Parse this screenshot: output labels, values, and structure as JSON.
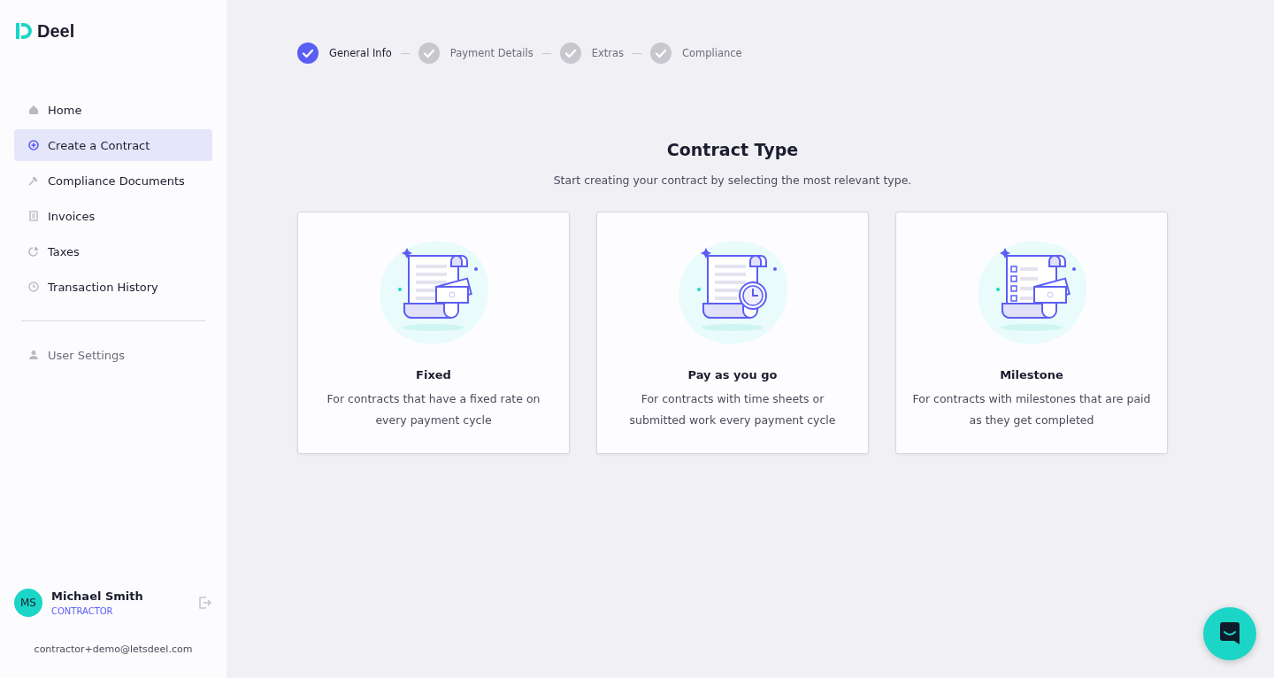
{
  "brand": {
    "name": "Deel"
  },
  "sidebar": {
    "items": [
      {
        "label": "Home",
        "kind": "home",
        "selected": false
      },
      {
        "label": "Create a Contract",
        "kind": "create",
        "selected": true
      },
      {
        "label": "Compliance Documents",
        "kind": "compliance",
        "selected": false
      },
      {
        "label": "Invoices",
        "kind": "invoices",
        "selected": false
      },
      {
        "label": "Taxes",
        "kind": "taxes",
        "selected": false
      },
      {
        "label": "Transaction History",
        "kind": "history",
        "selected": false
      }
    ],
    "settings_items": [
      {
        "label": "User Settings",
        "kind": "user",
        "selected": false
      }
    ],
    "user": {
      "initials": "MS",
      "name": "Michael Smith",
      "role": "CONTRACTOR",
      "email": "contractor+demo@letsdeel.com"
    }
  },
  "steps": [
    {
      "label": "General Info",
      "selected": true
    },
    {
      "label": "Payment Details",
      "selected": false
    },
    {
      "label": "Extras",
      "selected": false
    },
    {
      "label": "Compliance",
      "selected": false
    }
  ],
  "heading": "Contract Type",
  "subheading": "Start creating your contract by selecting the most relevant type.",
  "cards": [
    {
      "kind": "fixed",
      "title": "Fixed",
      "description": "For contracts that have a fixed rate on every payment cycle"
    },
    {
      "kind": "payg",
      "title": "Pay as you go",
      "description": "For contracts with time sheets or submitted work every payment cycle"
    },
    {
      "kind": "milestone",
      "title": "Milestone",
      "description": "For contracts with milestones that are paid as they get completed"
    }
  ]
}
